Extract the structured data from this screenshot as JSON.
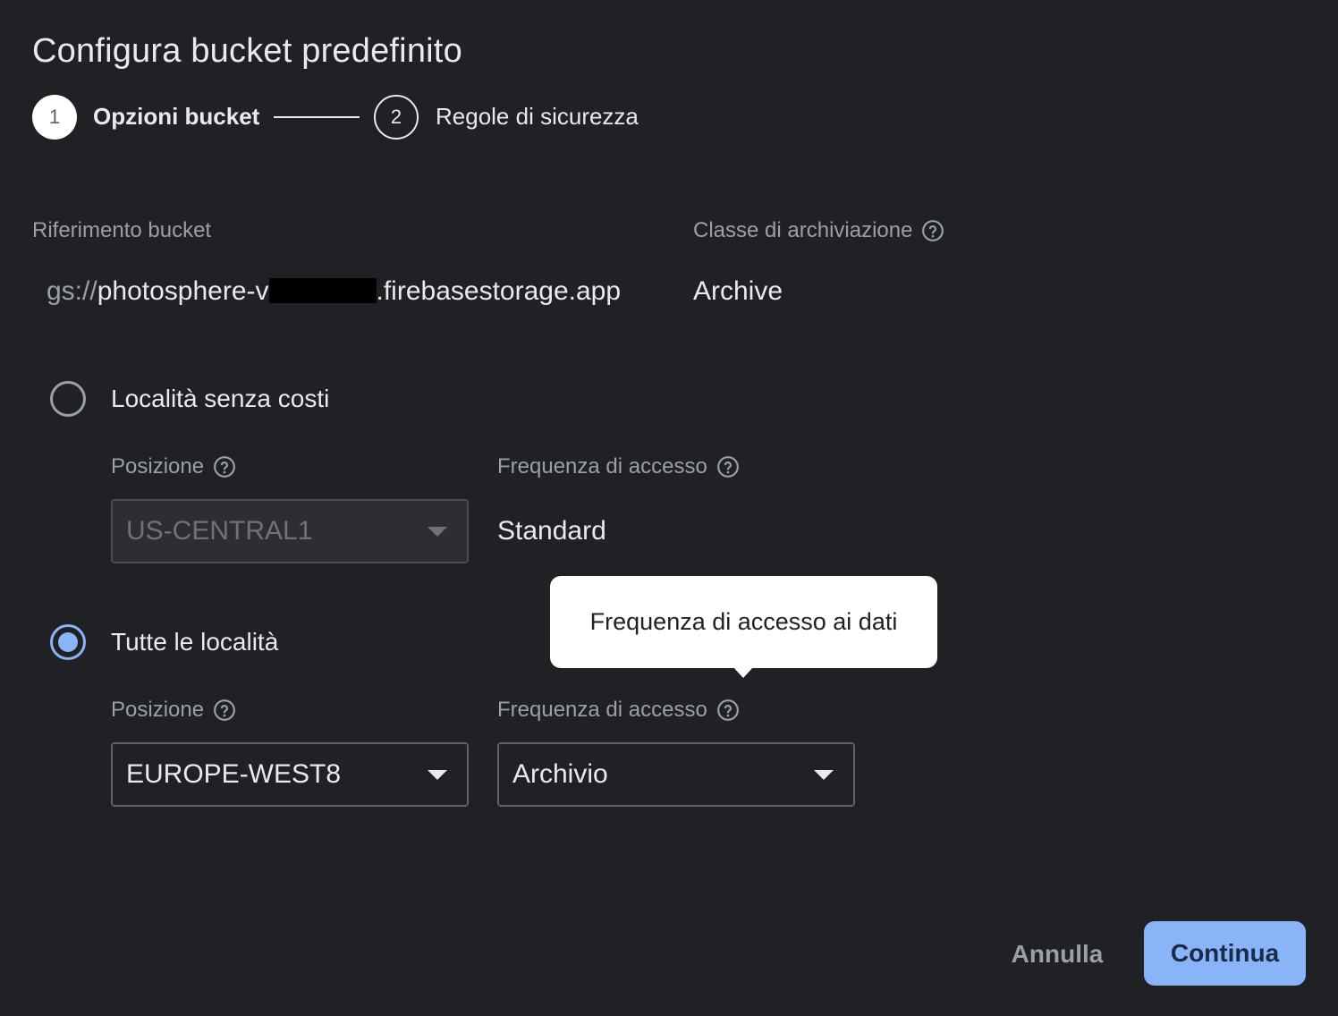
{
  "dialog": {
    "title": "Configura bucket predefinito"
  },
  "stepper": {
    "steps": [
      {
        "number": "1",
        "label": "Opzioni bucket",
        "state": "active"
      },
      {
        "number": "2",
        "label": "Regole di sicurezza",
        "state": "inactive"
      }
    ]
  },
  "bucket_reference": {
    "label": "Riferimento bucket",
    "prefix": "gs://",
    "name_start": "photosphere-v",
    "name_end": ".firebasestorage.app"
  },
  "storage_class": {
    "label": "Classe di archiviazione",
    "value": "Archive"
  },
  "options": {
    "free_location": {
      "label": "Località senza costi",
      "checked": false,
      "position_label": "Posizione",
      "position_value": "US-CENTRAL1",
      "frequency_label": "Frequenza di accesso",
      "frequency_value": "Standard"
    },
    "all_locations": {
      "label": "Tutte le località",
      "checked": true,
      "position_label": "Posizione",
      "position_value": "EUROPE-WEST8",
      "frequency_label": "Frequenza di accesso",
      "frequency_value": "Archivio"
    }
  },
  "tooltip": {
    "text": "Frequenza di accesso ai dati"
  },
  "actions": {
    "cancel_label": "Annulla",
    "continue_label": "Continua"
  },
  "colors": {
    "background": "#202124",
    "accent": "#8ab4f8",
    "text": "#e8eaed",
    "muted": "#9aa0a6"
  },
  "icons": {
    "help": "help-circle-icon",
    "dropdown": "chevron-down-icon"
  }
}
